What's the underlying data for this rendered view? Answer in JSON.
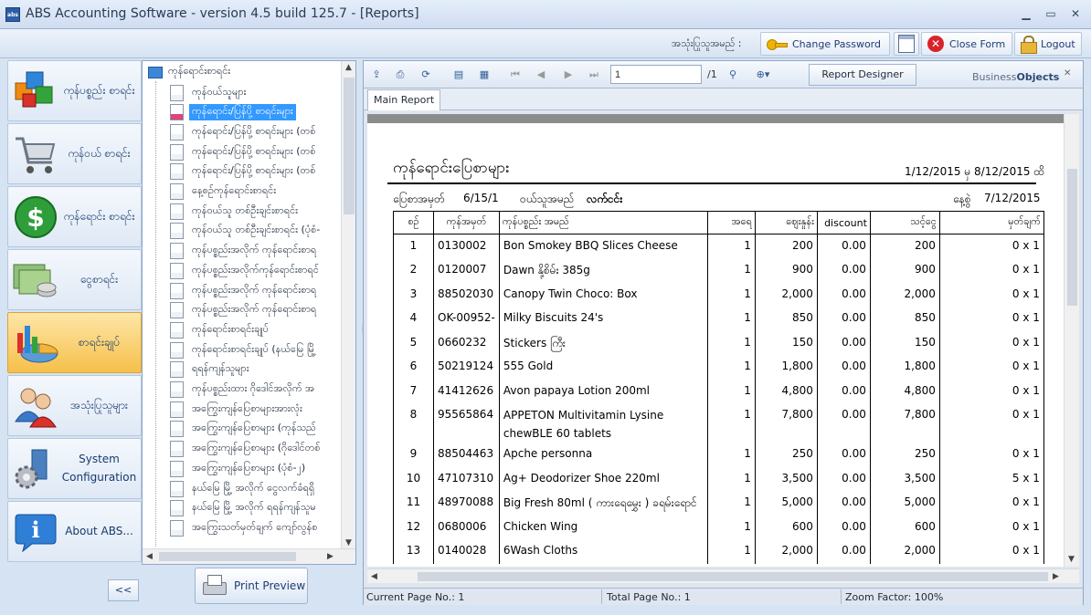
{
  "window": {
    "title": "ABS Accounting Software - version 4.5 build 125.7 - [Reports]",
    "icon_text": "abs",
    "minimize_glyph": "▁",
    "restore_glyph": "▭",
    "close_glyph": "✕"
  },
  "toolbar": {
    "user_label": "အသုံးပြုသူအမည် :",
    "change_password": "Change Password",
    "close_form": "Close Form",
    "logout": "Logout",
    "close_glyph": "✕"
  },
  "nav": {
    "items": [
      {
        "label": "ကုန်ပစ္စည်း စာရင်း",
        "icon": "cubes-icon"
      },
      {
        "label": "ကုန်ဝယ် စာရင်း",
        "icon": "shopping-cart-icon"
      },
      {
        "label": "ကုန်ရောင်း စာရင်း",
        "icon": "dollar-icon"
      },
      {
        "label": "ငွေစာရင်း",
        "icon": "money-icon"
      },
      {
        "label": "စာရင်းချုပ်",
        "icon": "chart-icon"
      },
      {
        "label": "အသုံးပြုသူများ",
        "icon": "users-icon"
      },
      {
        "label": "System Configuration",
        "icon": "system-config-icon"
      },
      {
        "label": "About ABS...",
        "icon": "info-icon"
      }
    ],
    "collapse_label": "<<",
    "active_index": 4
  },
  "tree": {
    "root": "ကုန်ရောင်းစာရင်း",
    "items": [
      "ကုန်ဝယ်သူများ",
      "ကုန်ရောင်း/ပြန်ပို့ စာရင်းများ",
      "ကုန်ရောင်း/ပြန်ပို့ စာရင်းများ (တစ်",
      "ကုန်ရောင်း/ပြန်ပို့ စာရင်းများ (တစ်",
      "ကုန်ရောင်း/ပြန်ပို့ စာရင်းများ (တစ်",
      "နေ့စဉ်ကုန်ရောင်းစာရင်း",
      "ကုန်ဝယ်သူ တစ်ဦးချင်းစာရင်း",
      "ကုန်ဝယ်သူ တစ်ဦးချင်းစာရင်း (ပုံစံ-",
      "ကုန်ပစ္စည်းအလိုက် ကုန်ရောင်းစာရ",
      "ကုန်ပစ္စည်းအလိုက်ကုန်ရောင်းစာရင်",
      "ကုန်ပစ္စည်းအလိုက် ကုန်ရောင်းစာရ",
      "ကုန်ပစ္စည်းအလိုက် ကုန်ရောင်းစာရ",
      "ကုန်ရောင်းစာရင်းချုပ်",
      "ကုန်ရောင်းစာရင်းချုပ် (နယ်မြေ မြို့",
      "ရရန်ကျန်သူများ",
      "ကုန်ပစ္စည်းထား ဂိုဒေါင်အလိုက် အ",
      "အကြွေးကျန်ပြေစာများအားလုံး",
      "အကြွေးကျန်ပြေစာများ (ကုန်သည်",
      "အကြွေးကျန်ပြေစာများ (ဂိုဒေါင်တစ်",
      "အကြွေးကျန်ပြေစာများ (ပုံစံ-၂)",
      "နယ်မြေ မြို့ အလိုက် ငွေလက်ခံရရှိ",
      "နယ်မြေ မြို့ အလိုက် ရရန်ကျန်သူမ",
      "အကြွေးသတ်မှတ်ချက် ကျော်လွန်စ"
    ],
    "selected_index": 1
  },
  "print_preview": "Print Preview",
  "viewer": {
    "page_number": "1",
    "page_total": "/1",
    "report_designer": "Report Designer",
    "business_objects_a": "Business",
    "business_objects_b": "Objects",
    "tab": "Main Report",
    "close_glyph": "✕"
  },
  "report": {
    "title": "ကုန်ရောင်းပြေစာများ",
    "date_range": "1/12/2015 မှ 8/12/2015 ထိ",
    "invoice_label": "ပြေစာအမှတ်",
    "invoice_no": "6/15/1",
    "customer_label": "ဝယ်သူအမည်",
    "customer_name": "လက်ငင်း",
    "date_label": "နေ့စွဲ",
    "date": "7/12/2015",
    "columns": [
      "စဉ်",
      "ကုန်အမှတ်",
      "ကုန်ပစ္စည်း အမည်",
      "အရေ",
      "ဈေးနှုန်း",
      "discount",
      "သင့်ငွေ",
      "မှတ်ချက်"
    ],
    "rows": [
      [
        "1",
        "0130002",
        "Bon Smokey BBQ Slices Cheese",
        "1",
        "200",
        "0.00",
        "200",
        "0 x 1"
      ],
      [
        "2",
        "0120007",
        "Dawn နို့စိမ်း 385g",
        "1",
        "900",
        "0.00",
        "900",
        "0 x 1"
      ],
      [
        "3",
        "88502030",
        "Canopy Twin Choco: Box",
        "1",
        "2,000",
        "0.00",
        "2,000",
        "0 x 1"
      ],
      [
        "4",
        "OK-00952-",
        " Milky  Biscuits 24's",
        "1",
        "850",
        "0.00",
        "850",
        "0 x 1"
      ],
      [
        "5",
        "0660232",
        " Stickers ကြီး",
        "1",
        "150",
        "0.00",
        "150",
        "0 x 1"
      ],
      [
        "6",
        "50219124",
        "555 Gold",
        "1",
        "1,800",
        "0.00",
        "1,800",
        "0 x 1"
      ],
      [
        "7",
        "41412626",
        "Avon papaya  Lotion  200ml",
        "1",
        "4,800",
        "0.00",
        "4,800",
        "0 x 1"
      ],
      [
        "8",
        "95565864",
        "APPETON Multivitamin Lysine chewBLE 60 tablets",
        "1",
        "7,800",
        "0.00",
        "7,800",
        "0 x 1"
      ],
      [
        "9",
        "88504463",
        "Apche personna",
        "1",
        "250",
        "0.00",
        "250",
        "0 x 1"
      ],
      [
        "10",
        "47107310",
        "Ag+ Deodorizer Shoe 220ml",
        "1",
        "3,500",
        "0.00",
        "3,500",
        "5 x 1"
      ],
      [
        "11",
        "48970088",
        "Big Fresh 80ml ( ကားရေမွှေး ) ခရမ်းရောင်",
        "1",
        "5,000",
        "0.00",
        "5,000",
        "0 x 1"
      ],
      [
        "12",
        "0680006",
        "Chicken Wing",
        "1",
        "600",
        "0.00",
        "600",
        "0 x 1"
      ],
      [
        "13",
        "0140028",
        "6Wash Cloths",
        "1",
        "2,000",
        "0.00",
        "2,000",
        "0 x 1"
      ]
    ]
  },
  "status": {
    "current_page": "Current Page No.: 1",
    "total_page": "Total Page No.: 1",
    "zoom": "Zoom Factor: 100%"
  }
}
